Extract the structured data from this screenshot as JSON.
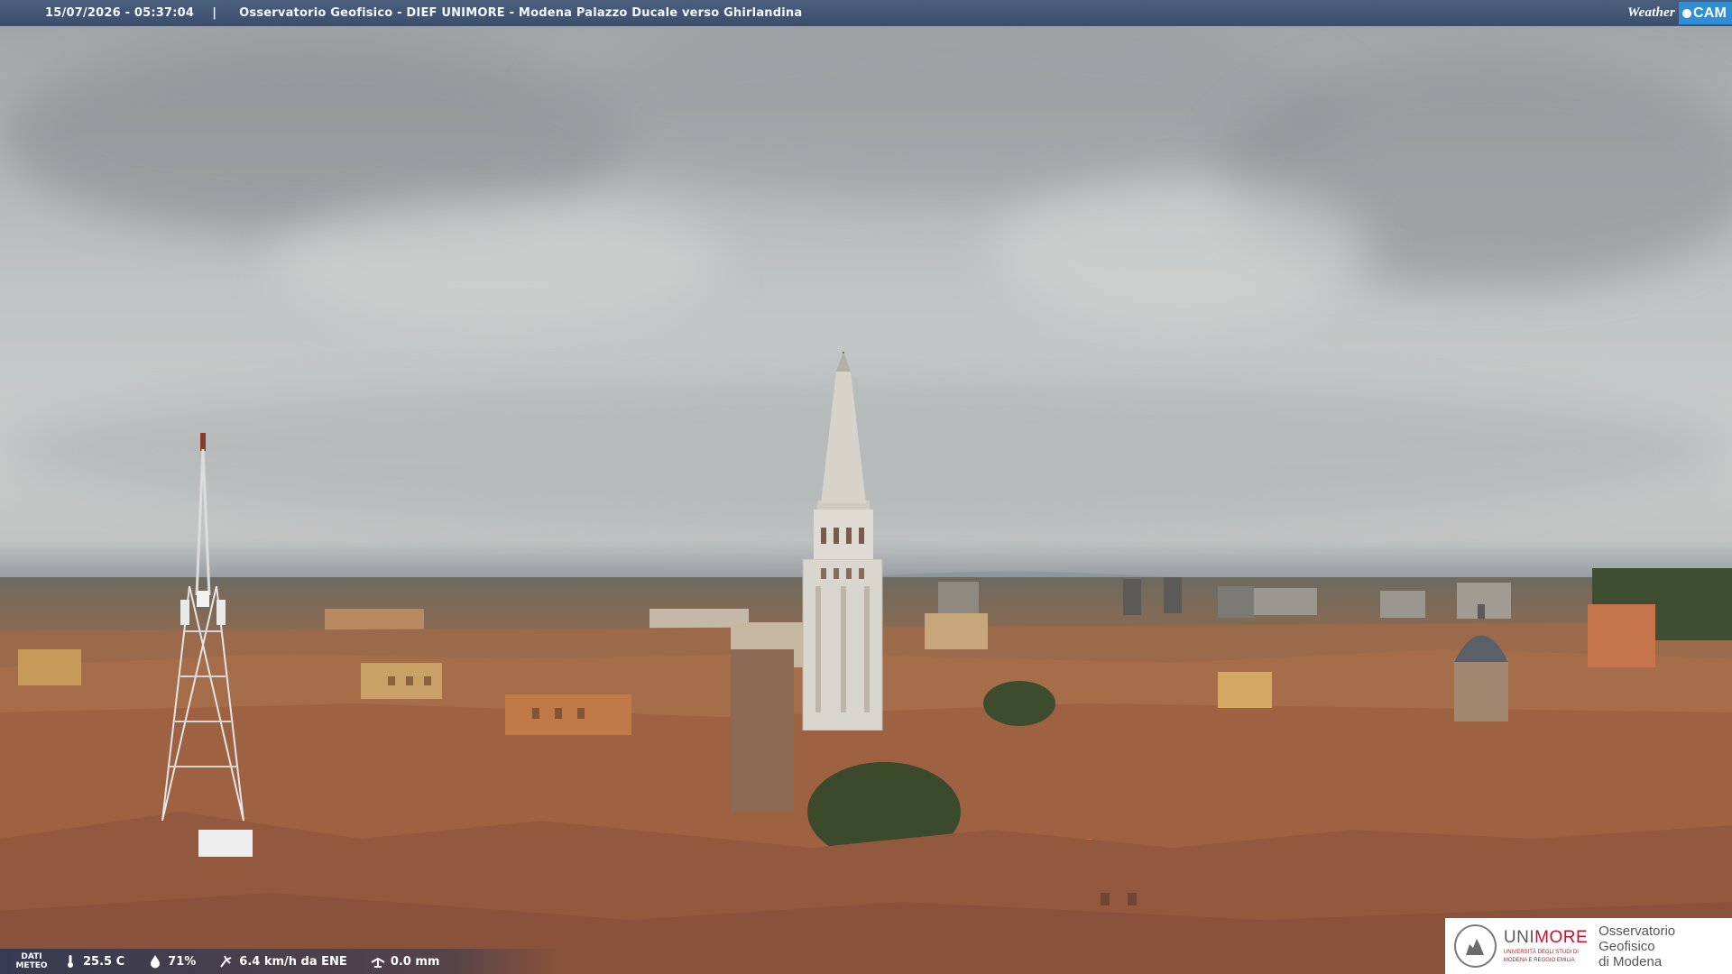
{
  "header": {
    "timestamp": "15/07/2026 - 05:37:04",
    "separator": "|",
    "title": "Osservatorio Geofisico - DIEF UNIMORE - Modena Palazzo Ducale verso Ghirlandina"
  },
  "brand": {
    "weather_text": "Weather",
    "cam_text": "CAM"
  },
  "weather": {
    "dati_label_1": "DATI",
    "dati_label_2": "METEO",
    "temperature": "25.5 C",
    "humidity": "71%",
    "wind": "6.4 km/h da ENE",
    "rain": "0.0 mm",
    "icons": [
      "thermometer-icon",
      "humidity-drop-icon",
      "wind-icon",
      "rain-gauge-icon"
    ]
  },
  "logo": {
    "uni": "UNI",
    "more": "MORE",
    "uni_sub_1": "UNIVERSITÀ DEGLI STUDI DI",
    "uni_sub_2": "MODENA E REGGIO EMILIA",
    "obs_line_1": "Osservatorio Geofisico",
    "obs_line_2": "di Modena",
    "accent_color": "#c8102e"
  },
  "colors": {
    "banner": "#3b4f6c",
    "cam_badge": "#2e8ed6"
  }
}
